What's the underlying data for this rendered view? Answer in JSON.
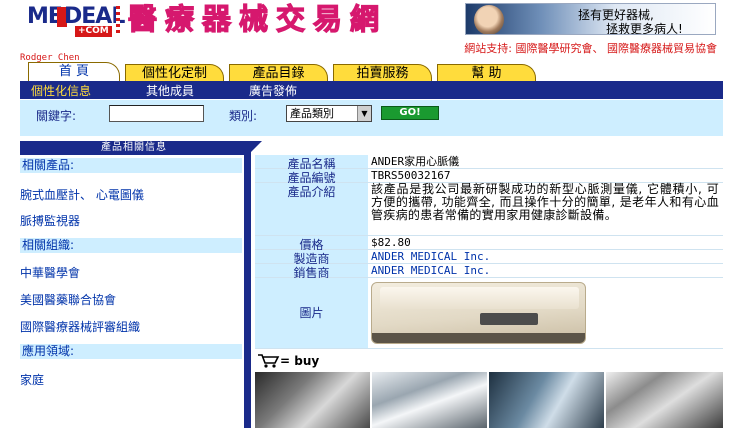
{
  "logo": {
    "text_me": "ME",
    "text_deal": "DEAL",
    "text_com": "+COM"
  },
  "brand": {
    "title": "醫療器械交易網"
  },
  "banner": {
    "line1": "拯有更好器械,",
    "line2": "拯救更多病人!"
  },
  "support": {
    "label": "網站支持:",
    "orgs": "國際醫學研究會、 國際醫療器械貿易協會"
  },
  "user": {
    "name": "Rodger Chen"
  },
  "tabs": [
    {
      "label": "首 頁",
      "active": true
    },
    {
      "label": "個性化定制",
      "active": false
    },
    {
      "label": "產品目錄",
      "active": false
    },
    {
      "label": "拍賣服務",
      "active": false
    },
    {
      "label": "幫  助",
      "active": false
    }
  ],
  "subnav": [
    {
      "label": "個性化信息",
      "active": true
    },
    {
      "label": "其他成員",
      "active": false
    },
    {
      "label": "廣告發佈",
      "active": false
    }
  ],
  "search": {
    "keyword_label": "關鍵字:",
    "keyword_value": "",
    "category_label": "類別:",
    "category_value": "產品類別",
    "go_label": "GO!"
  },
  "sidebar": {
    "header": "產品相關信息",
    "sections": [
      {
        "title": "相關產品:",
        "links": [
          "腕式血壓計、 心電圖儀",
          "脈搏監視器"
        ]
      },
      {
        "title": "相關組織:",
        "links": [
          "中華醫學會",
          "美國醫藥聯合協會",
          "國際醫療器械評審組織"
        ]
      },
      {
        "title": "應用領域:",
        "links": [
          "家庭"
        ]
      }
    ]
  },
  "product": {
    "name_label": "產品名稱",
    "name": "ANDER家用心脈儀",
    "code_label": "產品編號",
    "code": "TBRS50032167",
    "intro_label": "產品介紹",
    "intro": "該產品是我公司最新研製成功的新型心脈測量儀, 它體積小, 可方便的攜帶, 功能齊全, 而且操作十分的簡單, 是老年人和有心血管疾病的患者常備的實用家用健康診斷設備。",
    "price_label": "價格",
    "price": "$82.80",
    "maker_label": "製造商",
    "maker": "ANDER MEDICAL Inc.",
    "seller_label": "銷售商",
    "seller": "ANDER MEDICAL Inc.",
    "image_label": "圖片"
  },
  "buy": {
    "label": "= buy"
  },
  "icons": {
    "cart": "shopping-cart-icon",
    "dropdown": "chevron-down-icon"
  },
  "colors": {
    "navy": "#1a2a8a",
    "tab_yellow": "#ffdc3c",
    "light_blue": "#ceeeff",
    "link_blue": "#0033aa",
    "accent_red": "#d61818",
    "go_green": "#1a9a30"
  }
}
